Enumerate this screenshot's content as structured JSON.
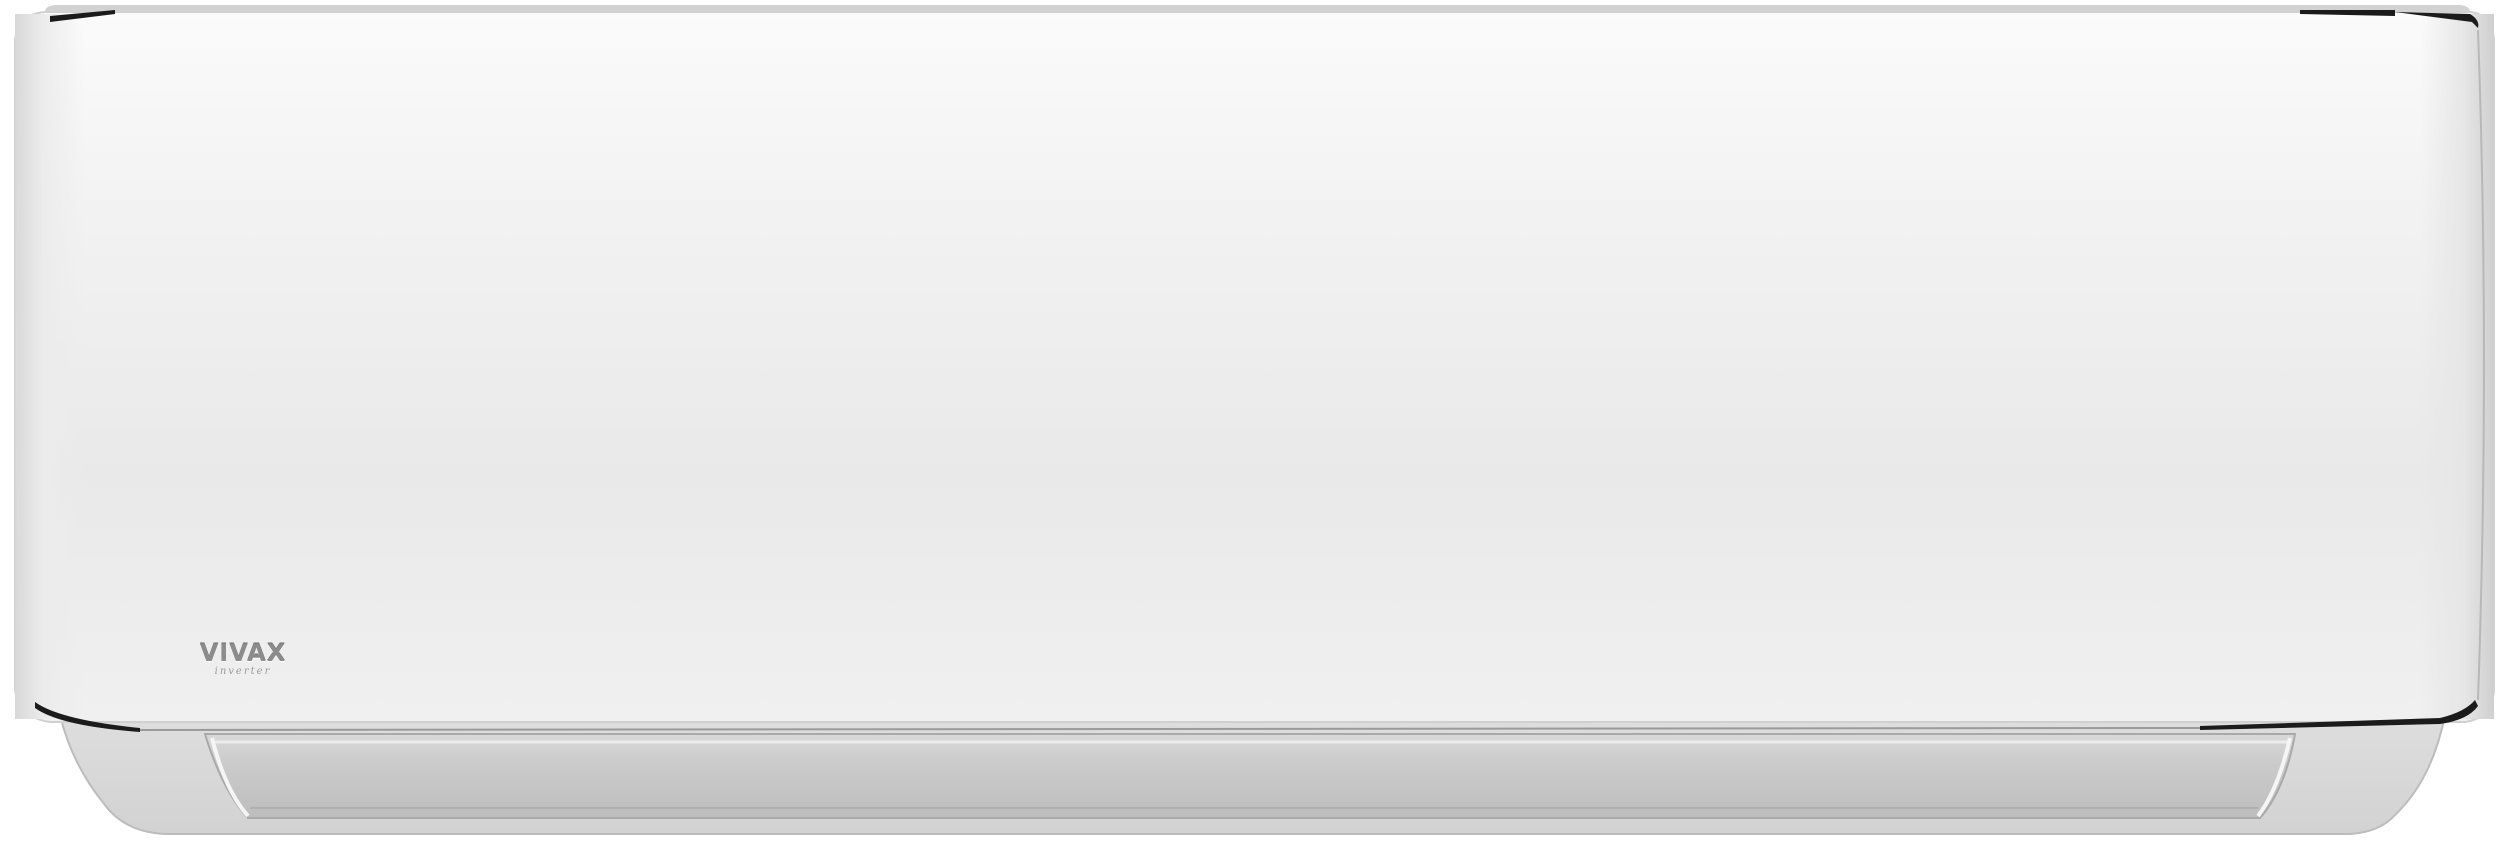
{
  "product": {
    "brand_name": "VIVAX",
    "brand_sub": "inverter",
    "colors": {
      "body": "#f2f2f2",
      "trim": "#1b1b1b",
      "louver": "#c6c6c6",
      "logo": "#8c8c8c"
    }
  }
}
